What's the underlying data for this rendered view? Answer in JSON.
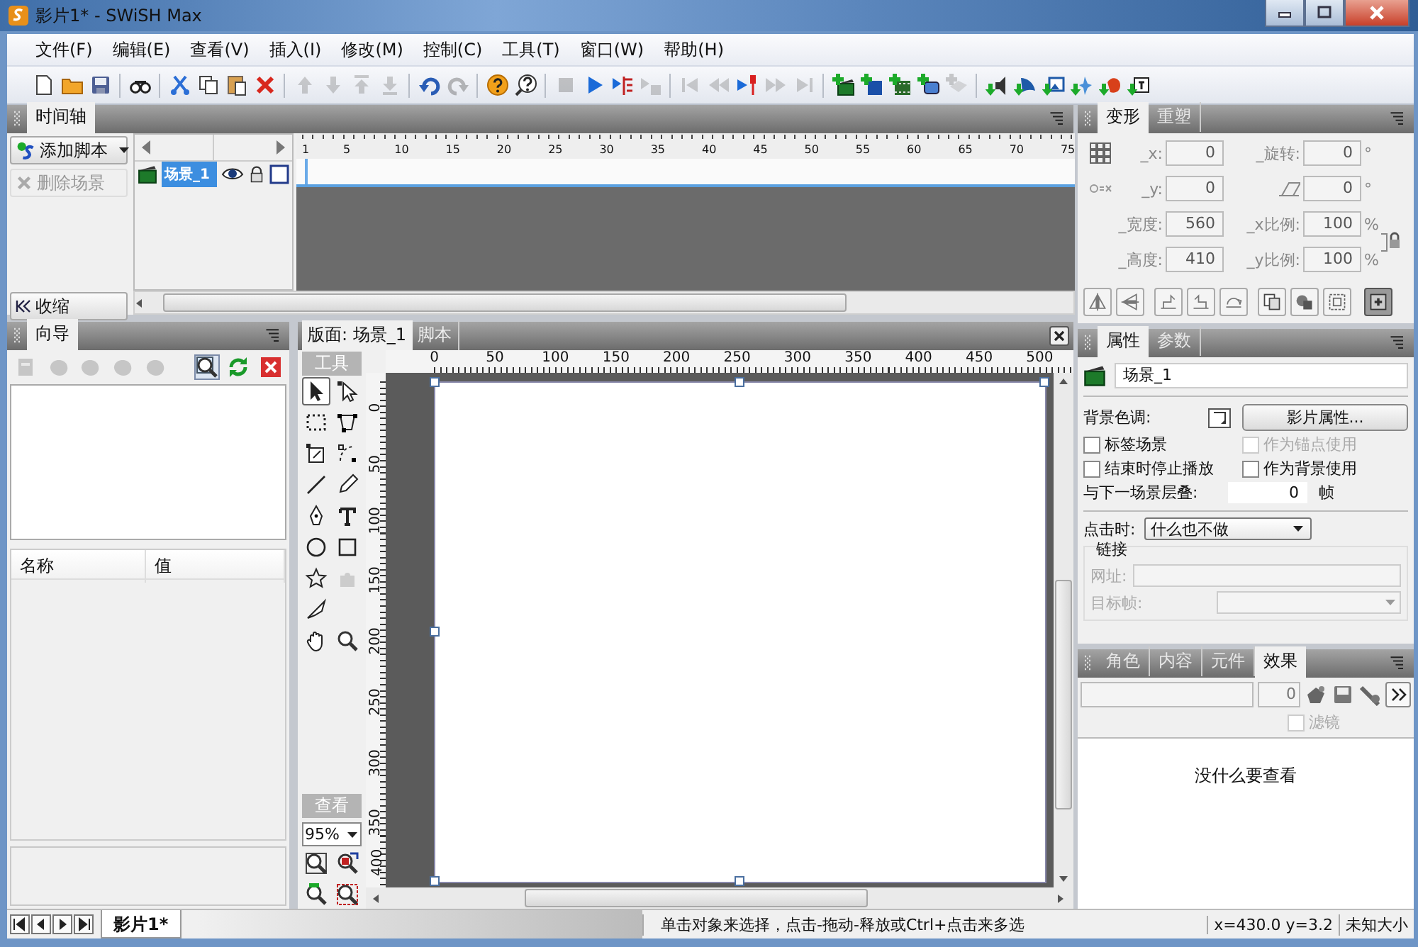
{
  "window": {
    "title": "影片1* - SWiSH Max"
  },
  "menu": [
    "文件(F)",
    "编辑(E)",
    "查看(V)",
    "插入(I)",
    "修改(M)",
    "控制(C)",
    "工具(T)",
    "窗口(W)",
    "帮助(H)"
  ],
  "toolbar": [
    {
      "buttons": [
        {
          "kind": "page",
          "disabled": false
        },
        {
          "kind": "folder",
          "disabled": false
        },
        {
          "kind": "disk",
          "disabled": false
        }
      ]
    },
    {
      "buttons": [
        {
          "kind": "binoculars",
          "disabled": false
        }
      ]
    },
    {
      "buttons": [
        {
          "kind": "scissors",
          "disabled": false
        },
        {
          "kind": "copy",
          "disabled": false
        },
        {
          "kind": "paste",
          "disabled": false
        },
        {
          "kind": "delete",
          "disabled": false
        }
      ]
    },
    {
      "buttons": [
        {
          "kind": "up",
          "disabled": true
        },
        {
          "kind": "down",
          "disabled": true
        },
        {
          "kind": "top",
          "disabled": true
        },
        {
          "kind": "bottom",
          "disabled": true
        }
      ]
    },
    {
      "buttons": [
        {
          "kind": "undo",
          "disabled": false
        },
        {
          "kind": "redo",
          "disabled": true
        }
      ]
    },
    {
      "buttons": [
        {
          "kind": "help",
          "disabled": false
        },
        {
          "kind": "helpsearch",
          "disabled": false
        }
      ]
    },
    {
      "buttons": [
        {
          "kind": "stop",
          "disabled": true
        },
        {
          "kind": "play",
          "disabled": false
        },
        {
          "kind": "playframe",
          "disabled": false
        },
        {
          "kind": "stopframe",
          "disabled": true
        }
      ]
    },
    {
      "buttons": [
        {
          "kind": "first",
          "disabled": true
        },
        {
          "kind": "rewind",
          "disabled": true
        },
        {
          "kind": "marker",
          "disabled": false
        },
        {
          "kind": "forward",
          "disabled": true
        },
        {
          "kind": "last",
          "disabled": true
        }
      ]
    },
    {
      "buttons": [
        {
          "kind": "add-scene",
          "disabled": false
        },
        {
          "kind": "add-sprite",
          "disabled": false
        },
        {
          "kind": "add-movie",
          "disabled": false
        },
        {
          "kind": "add-button",
          "disabled": false
        },
        {
          "kind": "add-shape",
          "disabled": true
        }
      ]
    },
    {
      "buttons": [
        {
          "kind": "import-sound",
          "disabled": false
        },
        {
          "kind": "import-anim",
          "disabled": false
        },
        {
          "kind": "import-image",
          "disabled": false
        },
        {
          "kind": "import-effect",
          "disabled": false
        },
        {
          "kind": "import-blob",
          "disabled": false
        },
        {
          "kind": "import-text",
          "disabled": false
        }
      ]
    }
  ],
  "timeline": {
    "title": "时间轴",
    "add_script": "添加脚本",
    "delete_scene": "删除场景",
    "collapse": "收缩",
    "ruler": [
      "1",
      "5",
      "10",
      "15",
      "20",
      "25",
      "30",
      "35",
      "40",
      "45",
      "50",
      "55",
      "60",
      "65",
      "70",
      "75"
    ],
    "layers": [
      {
        "name": "场景_1",
        "selected": true
      }
    ]
  },
  "wizard": {
    "title": "向导",
    "tools": [
      {
        "kind": "doc",
        "disabled": true,
        "selected": false
      },
      {
        "kind": "blob",
        "disabled": true,
        "selected": false
      },
      {
        "kind": "blob",
        "disabled": true,
        "selected": false
      },
      {
        "kind": "blob",
        "disabled": true,
        "selected": false
      },
      {
        "kind": "blob",
        "disabled": true,
        "selected": false
      },
      {
        "kind": "search",
        "disabled": false,
        "selected": true
      },
      {
        "kind": "refresh",
        "disabled": false,
        "selected": false
      },
      {
        "kind": "close",
        "disabled": false,
        "selected": false
      }
    ],
    "columns": [
      "名称",
      "值"
    ]
  },
  "stage": {
    "tabs": [
      {
        "label": "版面: 场景_1",
        "selected": true
      },
      {
        "label": "脚本",
        "selected": false
      }
    ],
    "tools_title": "工具",
    "tools": [
      {
        "kind": "pointer",
        "selected": true,
        "disabled": false
      },
      {
        "kind": "subselect",
        "selected": false,
        "disabled": false
      },
      {
        "kind": "marquee",
        "selected": false,
        "disabled": false
      },
      {
        "kind": "reshape",
        "selected": false,
        "disabled": false
      },
      {
        "kind": "scale",
        "selected": false,
        "disabled": false
      },
      {
        "kind": "motion",
        "selected": false,
        "disabled": false
      },
      {
        "kind": "line",
        "selected": false,
        "disabled": false
      },
      {
        "kind": "pencil",
        "selected": false,
        "disabled": false
      },
      {
        "kind": "pen",
        "selected": false,
        "disabled": false
      },
      {
        "kind": "text",
        "selected": false,
        "disabled": false
      },
      {
        "kind": "ellipse",
        "selected": false,
        "disabled": false
      },
      {
        "kind": "rect",
        "selected": false,
        "disabled": false
      },
      {
        "kind": "star",
        "selected": false,
        "disabled": false
      },
      {
        "kind": "puzzle",
        "selected": false,
        "disabled": true
      },
      {
        "kind": "knife",
        "selected": false,
        "disabled": false
      },
      {
        "kind": "hand",
        "selected": false,
        "disabled": false
      },
      {
        "kind": "zoom",
        "selected": false,
        "disabled": false
      }
    ],
    "view_title": "查看",
    "zoom": "95%",
    "view_tools": [
      {
        "kind": "zoom-area"
      },
      {
        "kind": "zoom-select"
      },
      {
        "kind": "zoom-100"
      },
      {
        "kind": "zoom-fit"
      }
    ],
    "hruler": [
      "0",
      "50",
      "100",
      "150",
      "200",
      "250",
      "300",
      "350",
      "400",
      "450",
      "500"
    ],
    "vruler": [
      "0",
      "50",
      "100",
      "150",
      "200",
      "250",
      "300",
      "350",
      "400"
    ]
  },
  "transform": {
    "tabs": [
      {
        "label": "变形",
        "selected": true
      },
      {
        "label": "重塑",
        "selected": false
      }
    ],
    "rows": [
      {
        "kind": "grid",
        "fields": [
          {
            "kind": "text",
            "label": "_x:",
            "value": "0"
          },
          {
            "kind": "text",
            "label": "_旋转:",
            "value": "0",
            "unit": "°"
          }
        ]
      },
      {
        "kind": "link",
        "fields": [
          {
            "kind": "text",
            "label": "_y:",
            "value": "0"
          },
          {
            "kind": "skew",
            "value": "0",
            "unit": "°"
          }
        ]
      },
      {
        "kind": "plain",
        "fields": [
          {
            "kind": "text",
            "label": "_宽度:",
            "value": "560"
          },
          {
            "kind": "text",
            "label": "_x比例:",
            "value": "100",
            "unit": "%"
          }
        ]
      },
      {
        "kind": "plain",
        "fields": [
          {
            "kind": "text",
            "label": "_高度:",
            "value": "410"
          },
          {
            "kind": "text",
            "label": "_y比例:",
            "value": "100",
            "unit": "%"
          }
        ]
      }
    ],
    "buttons": [
      {
        "kind": "flip-h",
        "selected": false
      },
      {
        "kind": "flip-v",
        "selected": false
      },
      {
        "kind": "rot-r",
        "selected": false
      },
      {
        "kind": "rot-l",
        "selected": false
      },
      {
        "kind": "rot-180",
        "selected": false
      },
      {
        "kind": "copy",
        "selected": false
      },
      {
        "kind": "merge",
        "selected": false
      },
      {
        "kind": "fit",
        "selected": false
      },
      {
        "kind": "snap",
        "selected": true
      }
    ]
  },
  "properties": {
    "tabs": [
      {
        "label": "属性",
        "selected": true
      },
      {
        "label": "参数",
        "selected": false
      }
    ],
    "name": "场景_1",
    "bg_label": "背景色调:",
    "movie_button": "影片属性...",
    "checks": [
      {
        "label": "标签场景",
        "checked": false,
        "disabled": false
      },
      {
        "label": "作为锚点使用",
        "checked": false,
        "disabled": true
      },
      {
        "label": "结束时停止播放",
        "checked": false,
        "disabled": false
      },
      {
        "label": "作为背景使用",
        "checked": false,
        "disabled": false
      }
    ],
    "overlap_label": "与下一场景层叠:",
    "overlap_value": "0",
    "overlap_unit": "帧",
    "click_label": "点击时:",
    "click_value": "什么也不做",
    "link_title": "链接",
    "url_label": "网址:",
    "target_label": "目标帧:"
  },
  "effects": {
    "tabs": [
      {
        "label": "角色",
        "selected": false
      },
      {
        "label": "内容",
        "selected": false
      },
      {
        "label": "元件",
        "selected": false
      },
      {
        "label": "效果",
        "selected": true
      }
    ],
    "count": "0",
    "filter": {
      "label": "滤镜",
      "checked": false,
      "disabled": true
    },
    "empty": "没什么要查看"
  },
  "scene_tabs": [
    {
      "label": "影片1*",
      "selected": true
    }
  ],
  "status": {
    "hint": "单击对象来选择，点击-拖动-释放或Ctrl+点击来多选",
    "coords": "x=430.0 y=3.2",
    "size": "未知大小"
  }
}
